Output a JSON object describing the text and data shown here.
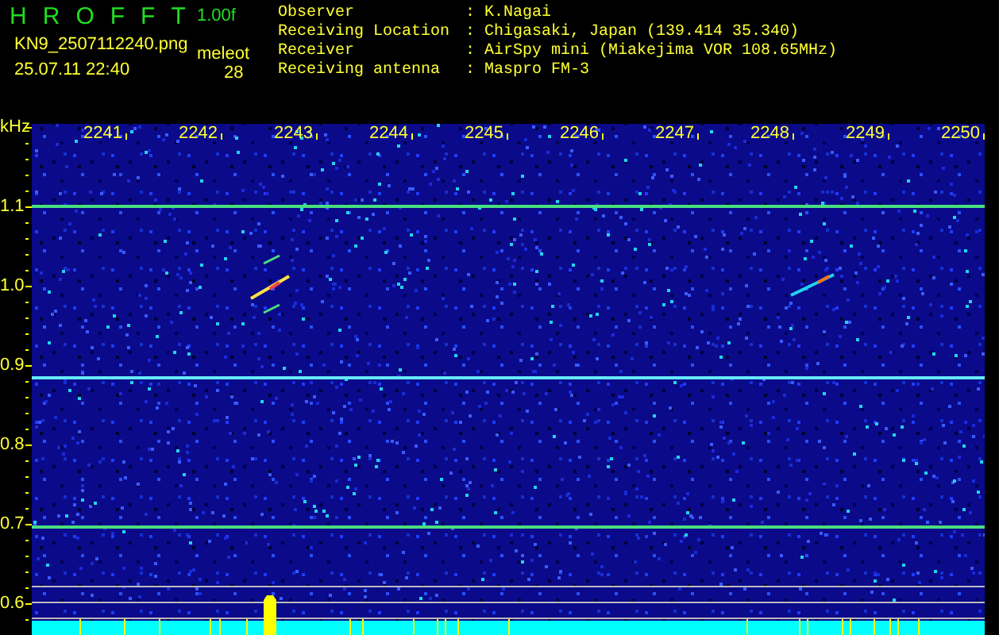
{
  "header": {
    "title_letters": [
      "H",
      "R",
      "O",
      "F",
      "F",
      "T"
    ],
    "version": "1.00f",
    "filename": "KN9_2507112240.png",
    "timestamp": "25.07.11 22:40",
    "meteor_label": "meleot",
    "meteor_count": "28"
  },
  "info": [
    {
      "label": "Observer",
      "separator": ":",
      "value": "K.Nagai"
    },
    {
      "label": "Receiving Location",
      "separator": ":",
      "value": "Chigasaki, Japan (139.414 35.340)"
    },
    {
      "label": "Receiver",
      "separator": ":",
      "value": "AirSpy mini (Miakejima VOR 108.65MHz)"
    },
    {
      "label": "Receiving antenna",
      "separator": ":",
      "value": "Maspro FM-3"
    }
  ],
  "plot": {
    "unit": "kHz",
    "x_labels": [
      "2241",
      "2242",
      "2243",
      "2244",
      "2245",
      "2246",
      "2247",
      "2248",
      "2249",
      "2250"
    ],
    "y_labels": [
      "1.1",
      "1.0",
      "0.9",
      "0.8",
      "0.7",
      "0.6"
    ]
  }
}
